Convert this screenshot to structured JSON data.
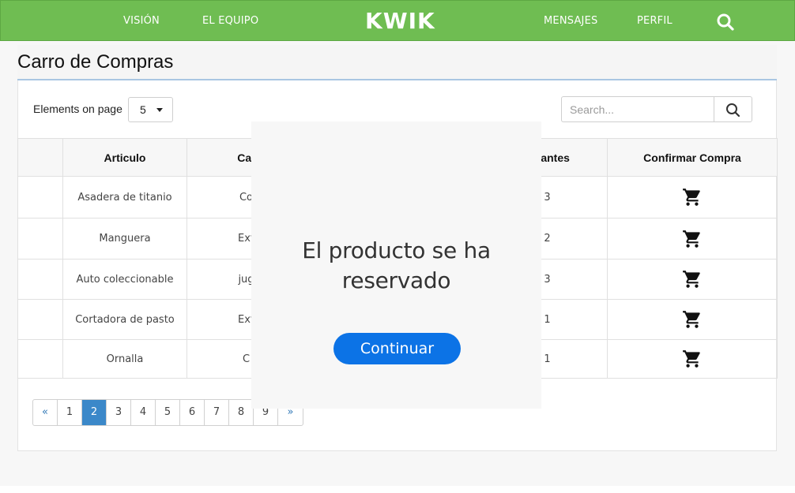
{
  "nav": {
    "links": [
      "VISIÓN",
      "EL EQUIPO",
      "MENSAJES",
      "PERFIL"
    ],
    "brand": "KWIK",
    "search_icon": "search-icon"
  },
  "page": {
    "title": "Carro de Compras"
  },
  "controls": {
    "elements_label": "Elements on page",
    "elements_value": "5",
    "search_placeholder": "Search..."
  },
  "table": {
    "headers": [
      "",
      "Articulo",
      "Cat",
      "",
      "estantes",
      "Confirmar Compra"
    ],
    "rows": [
      {
        "articulo": "Asadera de titanio",
        "categoria": "Co",
        "restantes": "3"
      },
      {
        "articulo": "Manguera",
        "categoria": "Ext",
        "restantes": "2"
      },
      {
        "articulo": "Auto coleccionable",
        "categoria": "jug",
        "restantes": "3"
      },
      {
        "articulo": "Cortadora de pasto",
        "categoria": "Ext",
        "restantes": "1"
      },
      {
        "articulo": "Ornalla",
        "categoria": "C",
        "restantes": "1"
      }
    ],
    "action_icon": "cart-icon"
  },
  "pagination": {
    "prev": "«",
    "pages": [
      "1",
      "2",
      "3",
      "4",
      "5",
      "6",
      "7",
      "8",
      "9"
    ],
    "active": "2",
    "next": "»"
  },
  "modal": {
    "line1": "El producto se ha",
    "line2": "reservado",
    "button": "Continuar"
  },
  "colors": {
    "nav": "#6fbd52",
    "accent": "#0c73e6",
    "active_page": "#3b88c9"
  }
}
